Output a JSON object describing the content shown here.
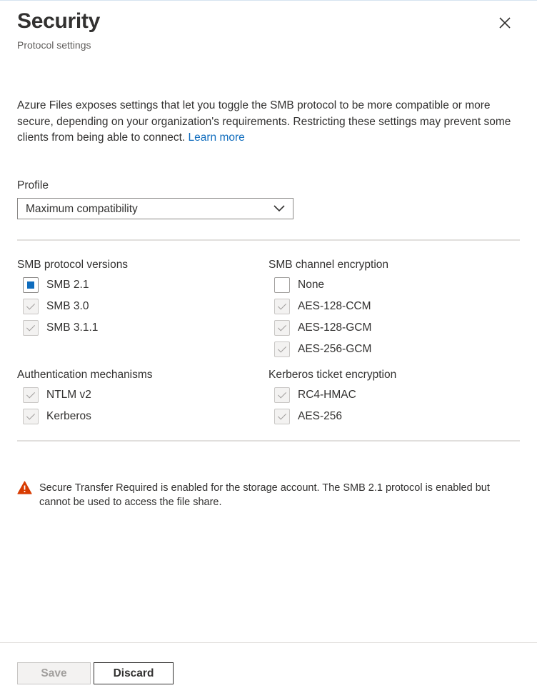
{
  "header": {
    "title": "Security",
    "subtitle": "Protocol settings",
    "close_icon": "close-icon"
  },
  "intro": {
    "text": "Azure Files exposes settings that let you toggle the SMB protocol to be more compatible or more secure, depending on your organization's requirements. Restricting these settings may prevent some clients from being able to connect.",
    "link_label": "Learn more"
  },
  "profile": {
    "label": "Profile",
    "selected": "Maximum compatibility"
  },
  "smb_versions": {
    "title": "SMB protocol versions",
    "items": [
      {
        "label": "SMB 2.1",
        "state": "indeterminate"
      },
      {
        "label": "SMB 3.0",
        "state": "checked-disabled"
      },
      {
        "label": "SMB 3.1.1",
        "state": "checked-disabled"
      }
    ]
  },
  "channel_encryption": {
    "title": "SMB channel encryption",
    "items": [
      {
        "label": "None",
        "state": "unchecked"
      },
      {
        "label": "AES-128-CCM",
        "state": "checked-disabled"
      },
      {
        "label": "AES-128-GCM",
        "state": "checked-disabled"
      },
      {
        "label": "AES-256-GCM",
        "state": "checked-disabled"
      }
    ]
  },
  "auth_mechanisms": {
    "title": "Authentication mechanisms",
    "items": [
      {
        "label": "NTLM v2",
        "state": "checked-disabled"
      },
      {
        "label": "Kerberos",
        "state": "checked-disabled"
      }
    ]
  },
  "kerberos_encryption": {
    "title": "Kerberos ticket encryption",
    "items": [
      {
        "label": "RC4-HMAC",
        "state": "checked-disabled"
      },
      {
        "label": "AES-256",
        "state": "checked-disabled"
      }
    ]
  },
  "warning": {
    "icon": "warning-icon",
    "text": "Secure Transfer Required is enabled for the storage account. The SMB 2.1 protocol is enabled but cannot be used to access the file share."
  },
  "footer": {
    "save_label": "Save",
    "discard_label": "Discard"
  },
  "colors": {
    "accent": "#0f6cbd",
    "warning": "#d83b01"
  }
}
